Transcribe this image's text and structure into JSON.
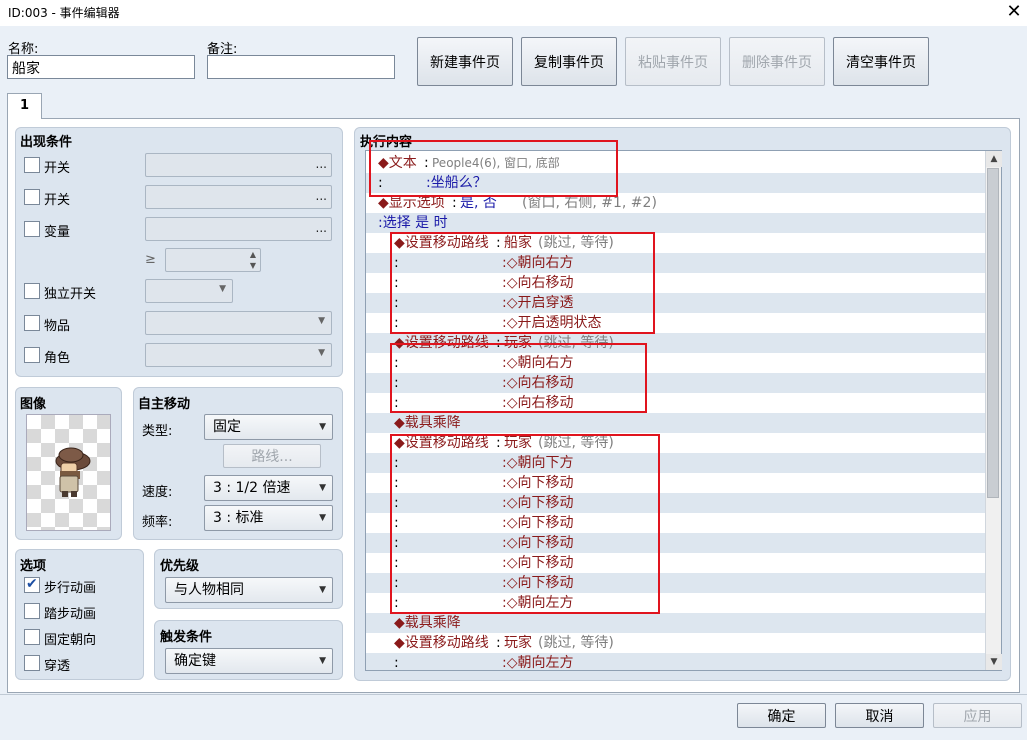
{
  "window": {
    "title": "ID:003 - 事件编辑器",
    "close": "✕"
  },
  "header": {
    "name_label": "名称:",
    "name_value": "船家",
    "note_label": "备注:",
    "note_value": "",
    "buttons": {
      "new_page": "新建事件页",
      "copy_page": "复制事件页",
      "paste_page": "粘贴事件页",
      "delete_page": "删除事件页",
      "clear_page": "清空事件页"
    }
  },
  "tab": {
    "label": "1"
  },
  "conditions": {
    "title": "出现条件",
    "switch1": "开关",
    "switch2": "开关",
    "variable": "变量",
    "ge": "≥",
    "self_switch": "独立开关",
    "item": "物品",
    "actor": "角色",
    "ellipsis": "..."
  },
  "image": {
    "title": "图像"
  },
  "autonomous": {
    "title": "自主移动",
    "type_label": "类型:",
    "type_value": "固定",
    "route_button": "路线...",
    "speed_label": "速度:",
    "speed_value": "3 : 1/2 倍速",
    "freq_label": "频率:",
    "freq_value": "3 : 标准"
  },
  "options": {
    "title": "选项",
    "walk": "步行动画",
    "step": "踏步动画",
    "fixed_dir": "固定朝向",
    "through": "穿透"
  },
  "priority": {
    "title": "优先级",
    "value": "与人物相同"
  },
  "trigger": {
    "title": "触发条件",
    "value": "确定键"
  },
  "contents": {
    "title": "执行内容",
    "rows": [
      {
        "a": "◆文本",
        "b": ":",
        "c": "People4(6), 窗口, 底部",
        "d": ""
      },
      {
        "a": ":",
        "b": "",
        "c": ":坐船么？",
        "d": ""
      },
      {
        "a": "◆显示选项",
        "b": ":",
        "c": "是, 否",
        "d": "(窗口, 右侧, #1, #2)"
      },
      {
        "a": ":选择 是 时",
        "b": "",
        "c": "",
        "d": ""
      },
      {
        "a": "◆设置移动路线",
        "b": ":",
        "c": "船家",
        "d": "(跳过, 等待)"
      },
      {
        "a": ":",
        "b": "",
        "c": ":◇朝向右方",
        "d": ""
      },
      {
        "a": ":",
        "b": "",
        "c": ":◇向右移动",
        "d": ""
      },
      {
        "a": ":",
        "b": "",
        "c": ":◇开启穿透",
        "d": ""
      },
      {
        "a": ":",
        "b": "",
        "c": ":◇开启透明状态",
        "d": ""
      },
      {
        "a": "◆设置移动路线",
        "b": ":",
        "c": "玩家",
        "d": "(跳过, 等待)"
      },
      {
        "a": ":",
        "b": "",
        "c": ":◇朝向右方",
        "d": ""
      },
      {
        "a": ":",
        "b": "",
        "c": ":◇向右移动",
        "d": ""
      },
      {
        "a": ":",
        "b": "",
        "c": ":◇向右移动",
        "d": ""
      },
      {
        "a": "◆载具乘降",
        "b": "",
        "c": "",
        "d": ""
      },
      {
        "a": "◆设置移动路线",
        "b": ":",
        "c": "玩家",
        "d": "(跳过, 等待)"
      },
      {
        "a": ":",
        "b": "",
        "c": ":◇朝向下方",
        "d": ""
      },
      {
        "a": ":",
        "b": "",
        "c": ":◇向下移动",
        "d": ""
      },
      {
        "a": ":",
        "b": "",
        "c": ":◇向下移动",
        "d": ""
      },
      {
        "a": ":",
        "b": "",
        "c": ":◇向下移动",
        "d": ""
      },
      {
        "a": ":",
        "b": "",
        "c": ":◇向下移动",
        "d": ""
      },
      {
        "a": ":",
        "b": "",
        "c": ":◇向下移动",
        "d": ""
      },
      {
        "a": ":",
        "b": "",
        "c": ":◇向下移动",
        "d": ""
      },
      {
        "a": ":",
        "b": "",
        "c": ":◇朝向左方",
        "d": ""
      },
      {
        "a": "◆载具乘降",
        "b": "",
        "c": "",
        "d": ""
      },
      {
        "a": "◆设置移动路线",
        "b": ":",
        "c": "玩家",
        "d": "(跳过, 等待)"
      },
      {
        "a": ":",
        "b": "",
        "c": ":◇朝向左方",
        "d": ""
      }
    ]
  },
  "footer": {
    "ok": "确定",
    "cancel": "取消",
    "apply": "应用"
  }
}
